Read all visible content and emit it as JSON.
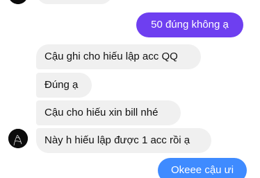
{
  "messages": {
    "outgoing_1": "50 đúng không ạ",
    "incoming_1": "Cậu ghi cho hiếu lập acc QQ",
    "incoming_2": "Đúng ạ",
    "incoming_3": "Cậu cho hiếu xin bill nhé",
    "incoming_4": "Này h hiếu lập được 1 acc rồi ạ",
    "outgoing_2": "Okeee cậu ưi"
  },
  "colors": {
    "outgoing_purple": "#6e3ff0",
    "outgoing_blue": "#3f8bff",
    "incoming_bg": "#f0f0f0"
  },
  "icons": {
    "avatar": "contact-avatar-icon"
  }
}
